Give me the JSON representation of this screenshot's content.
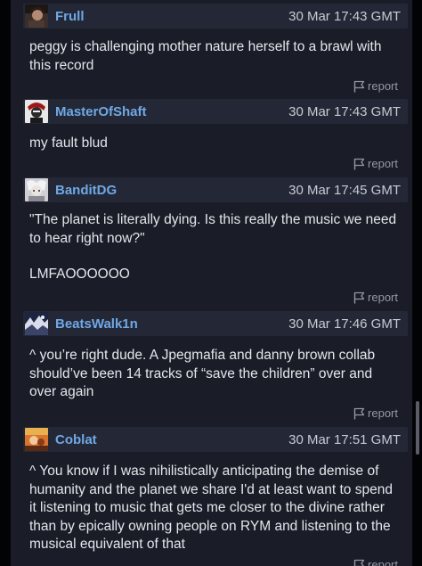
{
  "posts": [
    {
      "username": "Frull",
      "timestamp": "30 Mar 17:43 GMT",
      "body": [
        "peggy is challenging mother nature herself to a brawl with this record"
      ],
      "report_label": "report",
      "avatar_icon": "user-avatar-icon"
    },
    {
      "username": "MasterOfShaft",
      "timestamp": "30 Mar 17:43 GMT",
      "body": [
        "my fault blud"
      ],
      "report_label": "report",
      "avatar_icon": "user-avatar-icon"
    },
    {
      "username": "BanditDG",
      "timestamp": "30 Mar 17:45 GMT",
      "body": [
        "\"The planet is literally dying. Is this really the music we need to hear right now?\"",
        "LMFAOOOOOO"
      ],
      "report_label": "report",
      "avatar_icon": "user-avatar-icon"
    },
    {
      "username": "BeatsWalk1n",
      "timestamp": "30 Mar 17:46 GMT",
      "body": [
        "^ you’re right dude. A Jpegmafia and danny brown collab should’ve been 14 tracks of “save the children” over and over again"
      ],
      "report_label": "report",
      "avatar_icon": "user-avatar-icon"
    },
    {
      "username": "Coblat",
      "timestamp": "30 Mar 17:51 GMT",
      "body": [
        "^ You know if I was nihilistically anticipating the demise of humanity and the planet we share I'd at least want to spend it listening to music that gets me closer to the divine rather than by epically owning people on RYM and listening to the musical equivalent of that"
      ],
      "report_label": "report",
      "avatar_icon": "user-avatar-icon"
    }
  ],
  "colors": {
    "background": "#1a1d27",
    "header": "#242836",
    "username": "#6fa8e6",
    "text": "#e4e6ec",
    "muted": "#9398a6"
  }
}
